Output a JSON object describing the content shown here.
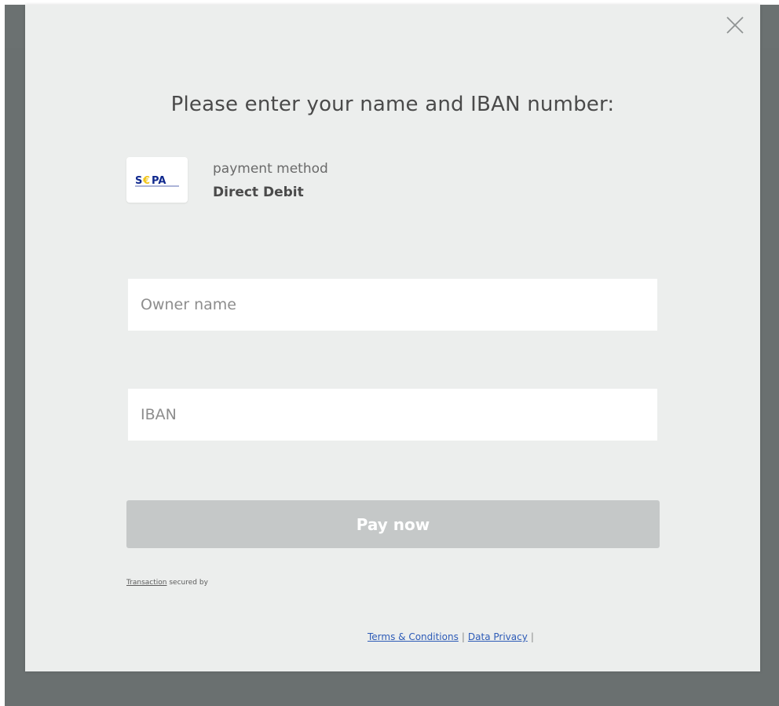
{
  "modal": {
    "title": "Please enter your name and IBAN number:",
    "close_icon": "close-icon"
  },
  "payment_method": {
    "caption": "payment method",
    "name": "Direct Debit",
    "logo_text": "S€PA",
    "logo_color": "#10298e",
    "logo_accent": "#f0c419"
  },
  "form": {
    "owner_placeholder": "Owner name",
    "owner_value": "",
    "iban_placeholder": "IBAN",
    "iban_value": "",
    "pay_label": "Pay now"
  },
  "footer": {
    "secured_word": "Transaction",
    "secured_rest": " secured by",
    "terms_label": "Terms & Conditions",
    "privacy_label": "Data Privacy",
    "separator": "|"
  },
  "colors": {
    "backdrop": "#6a7070",
    "modal_bg": "#eceeed",
    "button_disabled": "#c5c8c8",
    "link": "#2d5bb7"
  }
}
